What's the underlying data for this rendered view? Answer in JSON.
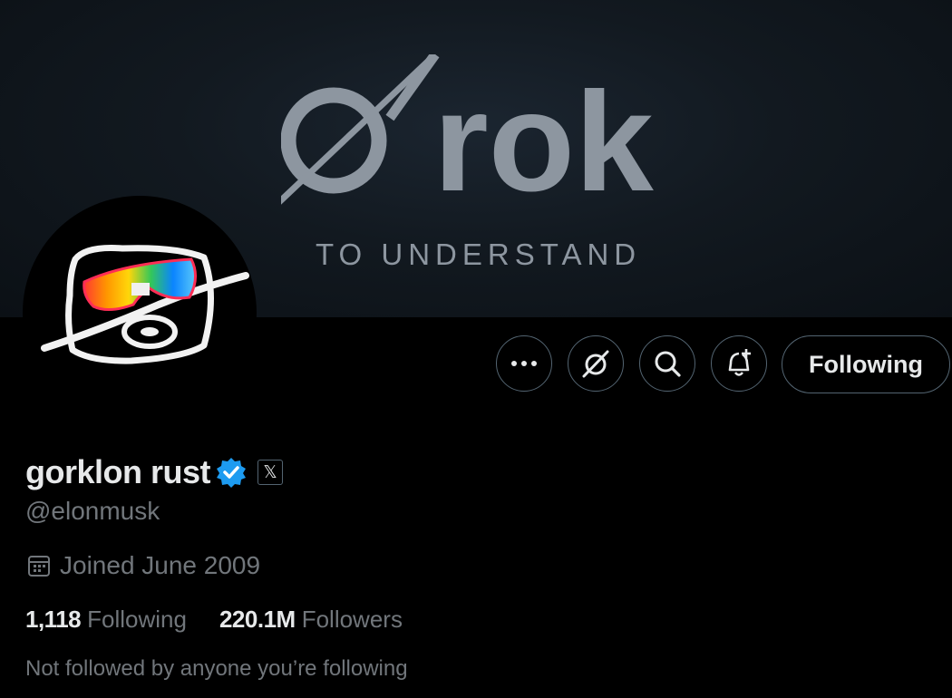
{
  "banner": {
    "logo_text": "rok",
    "tagline": "TO UNDERSTAND"
  },
  "actions": {
    "more_icon": "more-horizontal-icon",
    "grok_icon": "grok-icon",
    "search_icon": "search-icon",
    "notify_icon": "bell-plus-icon",
    "follow_label": "Following"
  },
  "profile": {
    "display_name": "gorklon rust",
    "verified_icon": "verified-badge-icon",
    "affiliate_badge": "𝕏",
    "handle": "@elonmusk",
    "joined": "Joined June 2009",
    "following_count": "1,118",
    "following_label": "Following",
    "followers_count": "220.1M",
    "followers_label": "Followers",
    "not_followed_text": "Not followed by anyone you’re following"
  },
  "colors": {
    "background": "#000000",
    "text_primary": "#e7e9ea",
    "text_secondary": "#71767b",
    "border": "#536471",
    "verified": "#1d9bf0"
  }
}
